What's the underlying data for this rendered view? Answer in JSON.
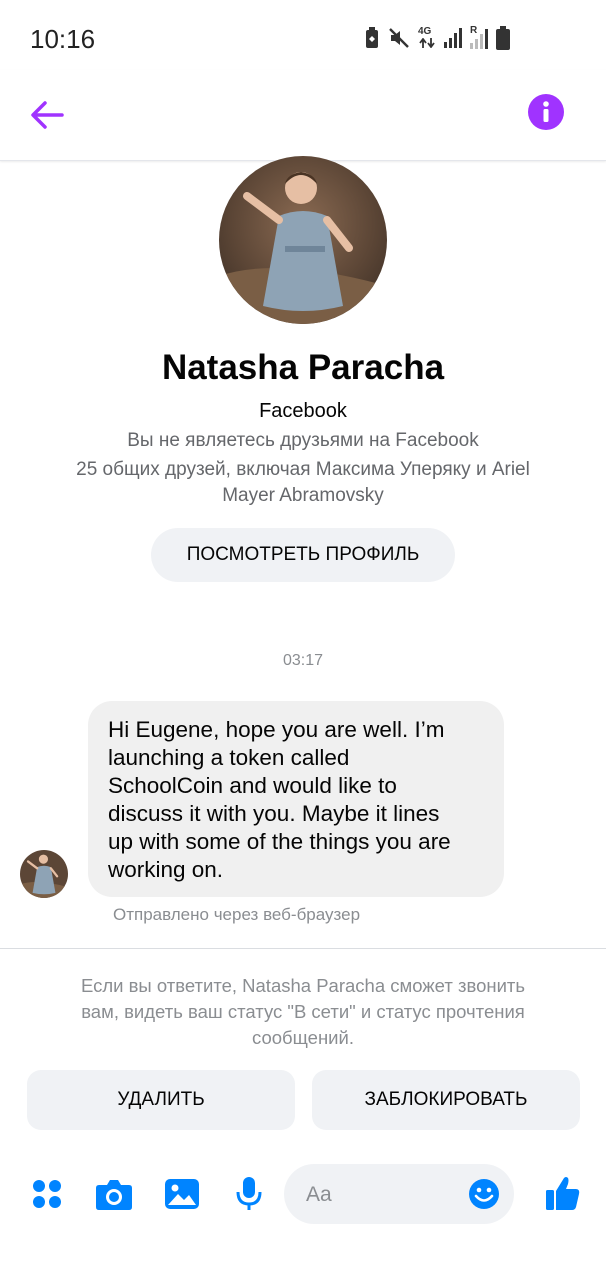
{
  "status_bar": {
    "time": "10:16",
    "icons": [
      "battery-saver-icon",
      "mute-icon",
      "4g-data-icon",
      "signal-icon",
      "roaming-signal-icon",
      "battery-icon"
    ],
    "network_label": "4G",
    "roaming_label": "R"
  },
  "header": {
    "back_icon": "arrow-left-icon",
    "info_icon": "info-icon",
    "accent_color": "#a033ff"
  },
  "profile": {
    "name": "Natasha Paracha",
    "source": "Facebook",
    "friend_status": "Вы не являетесь друзьями на Facebook",
    "mutual_friends_line1": "25 общих друзей, включая Максима Уперяку и Ariel",
    "mutual_friends_line2": "Mayer Abramovsky",
    "view_profile_label": "ПОСМОТРЕТЬ ПРОФИЛЬ"
  },
  "conversation": {
    "timestamp": "03:17",
    "message": {
      "lines": [
        "Hi Eugene, hope you are well. I’m",
        "launching a token called",
        "SchoolCoin and would like to",
        "discuss it with you. Maybe it lines",
        "up with some of the things you are",
        "working on."
      ],
      "sent_via": "Отправлено через веб-браузер"
    }
  },
  "request_notice": {
    "line1": "Если вы ответите, Natasha Paracha сможет звонить",
    "line2": "вам, видеть ваш статус \"В сети\" и статус прочтения",
    "line3": "сообщений.",
    "delete_label": "УДАЛИТЬ",
    "block_label": "ЗАБЛОКИРОВАТЬ"
  },
  "composer": {
    "placeholder": "Aa",
    "tools": [
      "apps-icon",
      "camera-icon",
      "gallery-icon",
      "microphone-icon"
    ],
    "emoji_icon": "emoji-icon",
    "like_icon": "thumbs-up-icon",
    "tool_color": "#0084ff"
  }
}
